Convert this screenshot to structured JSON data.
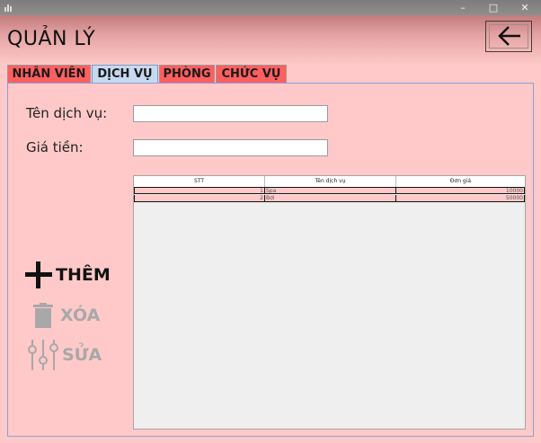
{
  "window": {
    "minimize": "–",
    "maximize": "□",
    "close": "✕"
  },
  "header": {
    "title": "QUẢN LÝ",
    "back_icon": "arrow-left-icon"
  },
  "tabs": [
    {
      "label": "NHÂN VIÊN",
      "active": false
    },
    {
      "label": "DỊCH VỤ",
      "active": true
    },
    {
      "label": "PHÒNG",
      "active": false
    },
    {
      "label": "CHỨC VỤ",
      "active": false
    }
  ],
  "form": {
    "service_name_label": "Tên dịch vụ:",
    "service_name_value": "",
    "price_label": "Giá tiền:",
    "price_value": ""
  },
  "table": {
    "columns": [
      "STT",
      "Tên dịch vụ",
      "Đơn giá"
    ],
    "rows": [
      [
        "1",
        "Spa",
        "10000"
      ],
      [
        "2",
        "Bơi",
        "50000"
      ]
    ]
  },
  "actions": {
    "add": {
      "label": "THÊM",
      "icon": "plus-icon",
      "enabled": true
    },
    "delete": {
      "label": "XÓA",
      "icon": "trash-icon",
      "enabled": false
    },
    "edit": {
      "label": "SỬA",
      "icon": "sliders-icon",
      "enabled": false
    }
  },
  "colors": {
    "background": "#ffc9c9",
    "tab": "#ff5f5f",
    "tab_active": "#c6d9f1",
    "disabled": "#a8a8a8"
  }
}
